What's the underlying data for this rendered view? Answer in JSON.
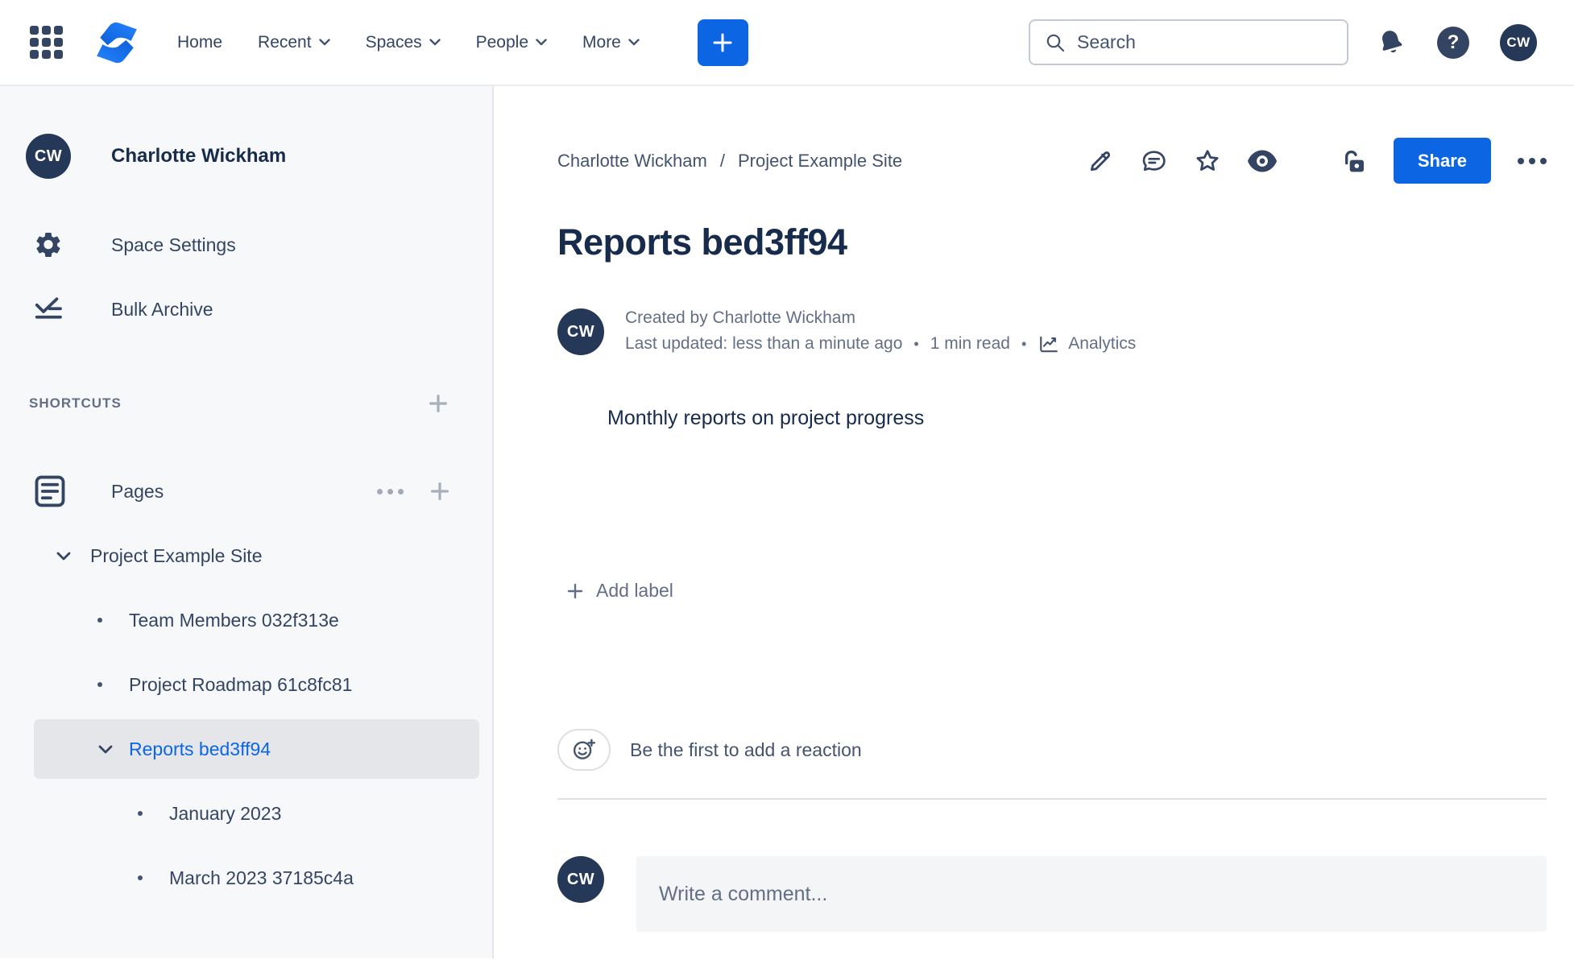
{
  "topnav": {
    "items": [
      {
        "label": "Home",
        "has_chevron": false
      },
      {
        "label": "Recent",
        "has_chevron": true
      },
      {
        "label": "Spaces",
        "has_chevron": true
      },
      {
        "label": "People",
        "has_chevron": true
      },
      {
        "label": "More",
        "has_chevron": true
      }
    ],
    "search": {
      "placeholder": "Search"
    },
    "avatar_initials": "CW",
    "help_glyph": "?"
  },
  "sidebar": {
    "space_name": "Charlotte Wickham",
    "avatar_initials": "CW",
    "menu": [
      {
        "label": "Space Settings"
      },
      {
        "label": "Bulk Archive"
      }
    ],
    "shortcuts_heading": "SHORTCUTS",
    "pages_label": "Pages",
    "tree": [
      {
        "label": "Project Example Site",
        "level": 0,
        "marker": "chevron",
        "selected": false
      },
      {
        "label": "Team Members 032f313e",
        "level": 1,
        "marker": "bullet",
        "selected": false
      },
      {
        "label": "Project Roadmap 61c8fc81",
        "level": 1,
        "marker": "bullet",
        "selected": false
      },
      {
        "label": "Reports bed3ff94",
        "level": 1,
        "marker": "chevron",
        "selected": true
      },
      {
        "label": "January 2023",
        "level": 2,
        "marker": "bullet",
        "selected": false
      },
      {
        "label": "March 2023 37185c4a",
        "level": 2,
        "marker": "bullet",
        "selected": false
      }
    ]
  },
  "main": {
    "breadcrumb": {
      "items": [
        "Charlotte Wickham",
        "Project Example Site"
      ],
      "separator": "/"
    },
    "share_label": "Share",
    "title": "Reports bed3ff94",
    "byline": {
      "avatar_initials": "CW",
      "created": "Created by Charlotte Wickham",
      "updated": "Last updated: less than a minute ago",
      "dot": "•",
      "read_time": "1 min read",
      "analytics_label": "Analytics"
    },
    "body_text": "Monthly reports on project progress",
    "add_label_text": "Add label",
    "reaction_prompt": "Be the first to add a reaction",
    "comment": {
      "avatar_initials": "CW",
      "placeholder": "Write a comment..."
    }
  },
  "colors": {
    "accent_blue": "#0C66E4",
    "brand_blue": "#2684FF",
    "navy_text": "#172B4D",
    "icon_navy": "#344563",
    "gray_text": "#626F86",
    "sidebar_bg": "#F7F8F9",
    "selected_pill": "#E4E6EA",
    "avatar_bg": "#253858"
  }
}
